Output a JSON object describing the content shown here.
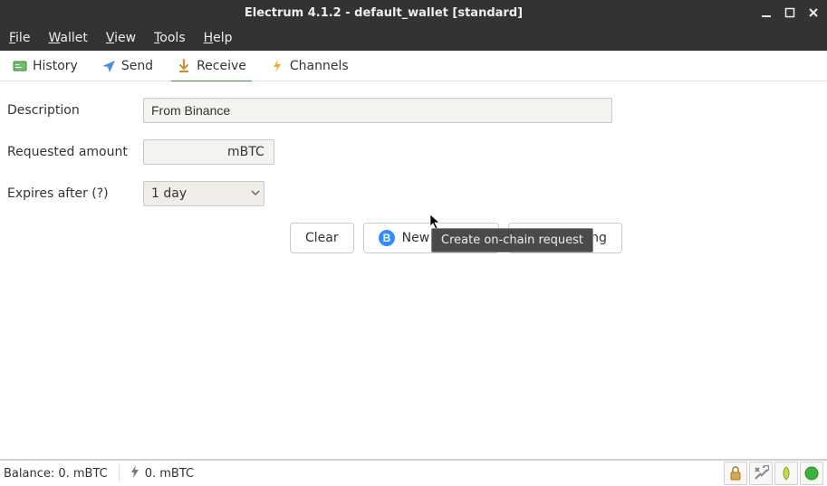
{
  "window": {
    "title": "Electrum 4.1.2  -  default_wallet  [standard]"
  },
  "menu": {
    "file": "File",
    "wallet": "Wallet",
    "view": "View",
    "tools": "Tools",
    "help": "Help"
  },
  "tabs": {
    "history": "History",
    "send": "Send",
    "receive": "Receive",
    "channels": "Channels",
    "active": "receive"
  },
  "form": {
    "description_label": "Description",
    "description_value": "From Binance",
    "amount_label": "Requested amount",
    "amount_value": "",
    "amount_unit": "mBTC",
    "expires_label": "Expires after (?)",
    "expires_value": "1 day"
  },
  "buttons": {
    "clear": "Clear",
    "new_address": "New Address",
    "lightning": "Lightning"
  },
  "tooltip": "Create on-chain request",
  "status": {
    "balance": "Balance: 0. mBTC",
    "lightning_balance": "0. mBTC"
  },
  "colors": {
    "titlebar_bg": "#333333",
    "accent_green": "#2e9e2e",
    "btc_blue": "#f7931a_inverse_actually_blue_#2f8fff",
    "lightning_orange": "#f5a623",
    "status_dot": "#3bb33b"
  }
}
